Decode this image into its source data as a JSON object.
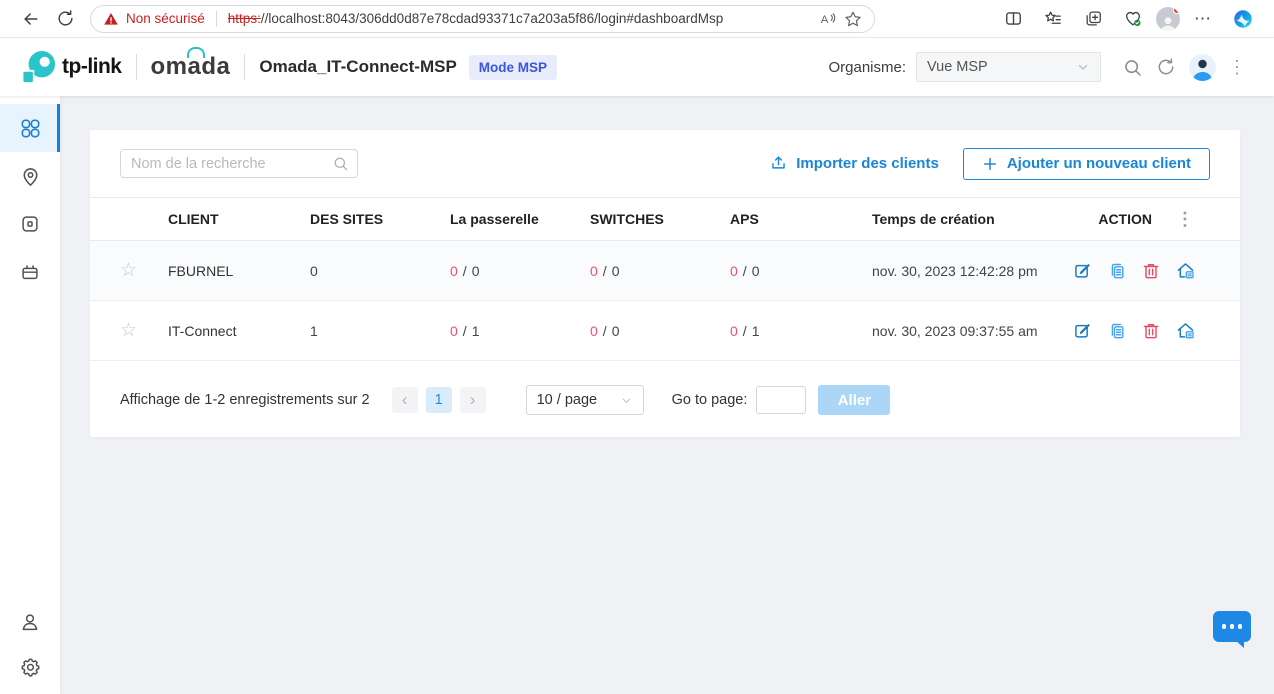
{
  "browser": {
    "security_warning": "Non sécurisé",
    "url_scheme": "https:",
    "url_rest": "//localhost:8043/306dd0d87e78cdad93371c7a203a5f86/login#dashboardMsp"
  },
  "header": {
    "brand": "tp-link",
    "product_prefix": "om",
    "product_arc_letter": "a",
    "product_suffix": "da",
    "title": "Omada_IT-Connect-MSP",
    "mode_badge": "Mode MSP",
    "organisme_label": "Organisme:",
    "organisme_value": "Vue MSP"
  },
  "toolbar": {
    "search_placeholder": "Nom de la recherche",
    "import_label": "Importer des clients",
    "add_label": "Ajouter un nouveau client"
  },
  "table": {
    "headers": {
      "client": "CLIENT",
      "sites": "DES SITES",
      "gateway": "La passerelle",
      "switches": "SWITCHES",
      "aps": "APS",
      "created": "Temps de création",
      "action": "ACTION"
    },
    "separator": "/",
    "rows": [
      {
        "client": "FBURNEL",
        "sites": "0",
        "gateway_down": "0",
        "gateway_total": "0",
        "switches_down": "0",
        "switches_total": "0",
        "aps_down": "0",
        "aps_total": "0",
        "created": "nov. 30, 2023 12:42:28 pm"
      },
      {
        "client": "IT-Connect",
        "sites": "1",
        "gateway_down": "0",
        "gateway_total": "1",
        "switches_down": "0",
        "switches_total": "0",
        "aps_down": "0",
        "aps_total": "1",
        "created": "nov. 30, 2023 09:37:55 am"
      }
    ]
  },
  "pagination": {
    "summary": "Affichage de 1-2 enregistrements sur 2",
    "current_page": "1",
    "page_size": "10 / page",
    "goto_label": "Go to page:",
    "go_button": "Aller"
  },
  "icons": {
    "star_outline": "☆",
    "kebab_vertical": "⋮",
    "browser_menu": "⋯",
    "prev": "‹",
    "next": "›",
    "read_aloud_letter": "A"
  },
  "colors": {
    "accent_blue": "#1b86d8",
    "badge_blue": "#3a56e0",
    "alert_red": "#f0506e",
    "brand_teal": "#2bc0c6"
  }
}
